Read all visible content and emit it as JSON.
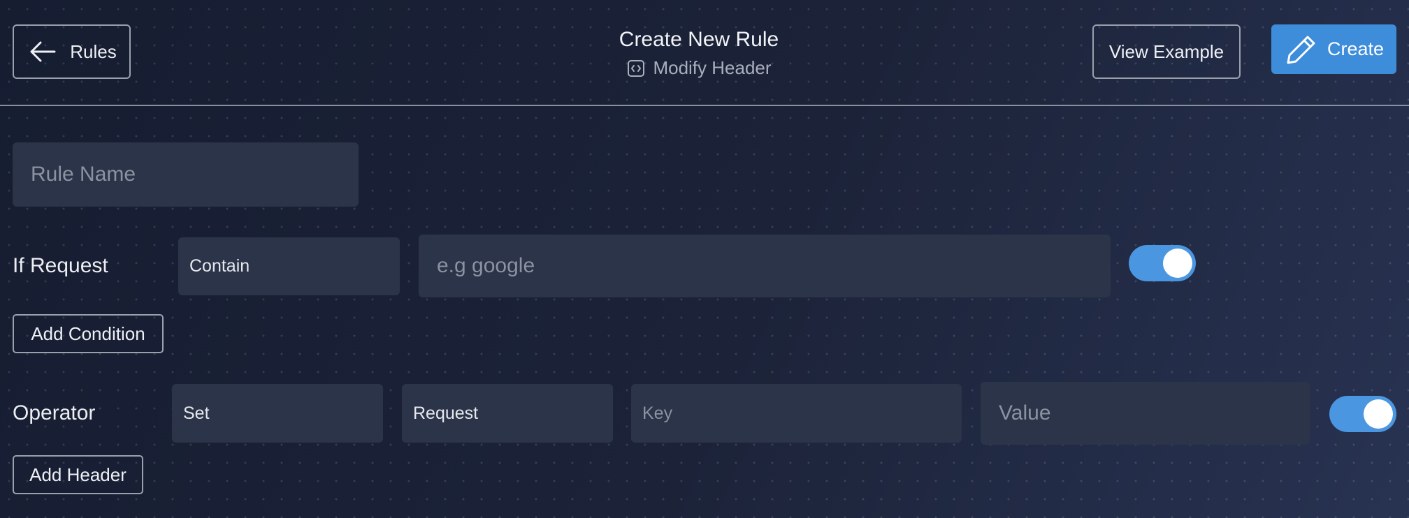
{
  "header": {
    "back_label": "Rules",
    "title": "Create New Rule",
    "subtitle": "Modify Header",
    "view_example_label": "View Example",
    "create_label": "Create"
  },
  "form": {
    "rule_name": {
      "placeholder": "Rule Name",
      "value": ""
    },
    "condition": {
      "label": "If Request",
      "match_type": "Contain",
      "url": {
        "placeholder": "e.g google",
        "value": ""
      },
      "enabled": true,
      "add_label": "Add Condition"
    },
    "operator": {
      "label": "Operator",
      "action": "Set",
      "target": "Request",
      "key": {
        "placeholder": "Key",
        "value": ""
      },
      "value": {
        "placeholder": "Value",
        "value": ""
      },
      "enabled": true,
      "add_label": "Add Header"
    }
  },
  "colors": {
    "accent": "#3d8ddb",
    "toggle_on": "#4a96e0",
    "field_bg": "#2b3448",
    "page_bg": "#1b2238"
  },
  "icons": {
    "back": "arrow-left-icon",
    "subtitle": "code-icon",
    "create": "pencil-icon"
  }
}
